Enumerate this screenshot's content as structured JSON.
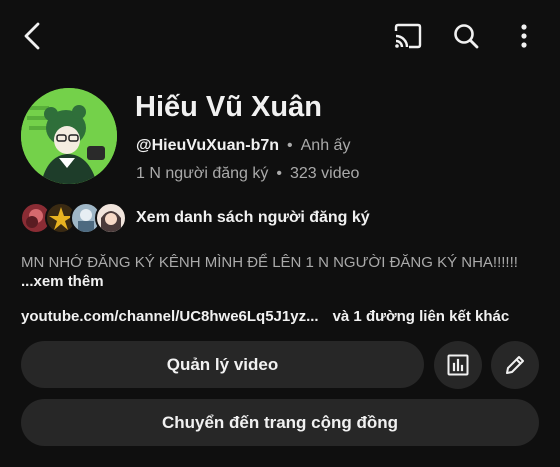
{
  "header": {
    "back_icon": "arrow-back-icon",
    "cast_icon": "cast-icon",
    "search_icon": "search-icon",
    "more_icon": "more-vertical-icon"
  },
  "channel": {
    "name": "Hiếu Vũ Xuân",
    "handle": "@HieuVuXuan-b7n",
    "handle_suffix": "Anh ấy",
    "subscribers": "1 N người đăng ký",
    "videos": "323 video",
    "avatar_color": "#74d14a"
  },
  "subscribers_preview": {
    "link_label": "Xem danh sách người đăng ký"
  },
  "description": {
    "text": "MN NHỚ ĐĂNG KÝ KÊNH MÌNH ĐỂ LÊN 1 N NGƯỜI ĐĂNG KÝ NHA!!!!!!",
    "more_label": "...xem thêm"
  },
  "links": {
    "url": "youtube.com/channel/UC8hwe6Lq5J1yz...",
    "more_links": "và 1 đường liên kết khác"
  },
  "actions": {
    "manage_label": "Quản lý video",
    "community_label": "Chuyển đến trang cộng đồng",
    "analytics_icon": "analytics-icon",
    "edit_icon": "edit-pencil-icon"
  }
}
